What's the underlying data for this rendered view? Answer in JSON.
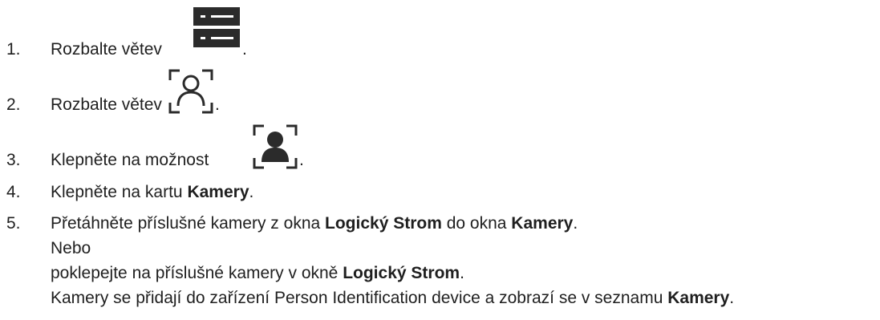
{
  "steps": [
    {
      "num": "1.",
      "text": "Rozbalte větev",
      "icon": "server-list-icon",
      "after": "."
    },
    {
      "num": "2.",
      "text": "Rozbalte větev",
      "icon": "person-identification-outline-icon",
      "after": "."
    },
    {
      "num": "3.",
      "text": "Klepněte na možnost",
      "icon": "person-identification-filled-icon",
      "after": "."
    },
    {
      "num": "4.",
      "pre": "Klepněte na kartu ",
      "bold": "Kamery",
      "post": "."
    },
    {
      "num": "5.",
      "pre": "Přetáhněte příslušné kamery z okna ",
      "bold1": "Logický Strom",
      "mid": " do okna ",
      "bold2": "Kamery",
      "post": "."
    }
  ],
  "continuation": {
    "or_label": "Nebo",
    "alt_pre": "poklepejte na příslušné kamery v okně ",
    "alt_bold": "Logický Strom",
    "alt_post": ".",
    "result_pre": "Kamery se přidají do zařízení Person Identification device a zobrazí se v seznamu ",
    "result_bold": "Kamery",
    "result_post": "."
  },
  "colors": {
    "text": "#1f1f1f",
    "icon_dark": "#2b2b2b"
  }
}
